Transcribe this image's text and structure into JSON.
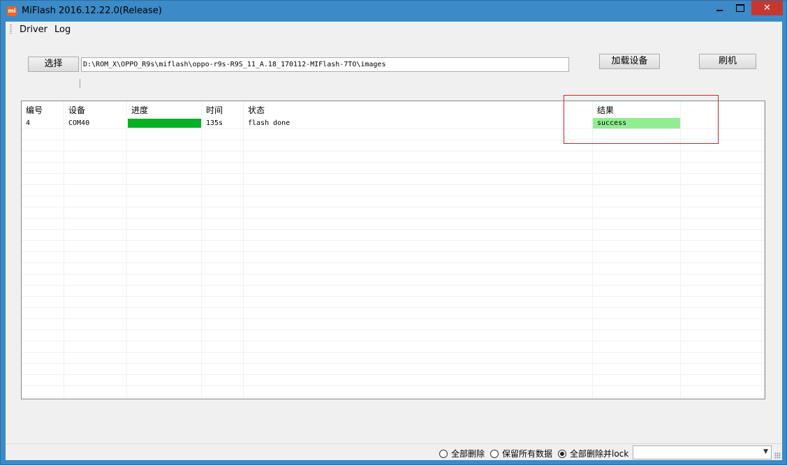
{
  "window": {
    "title": "MiFlash 2016.12.22.0(Release)",
    "app_icon_text": "mi",
    "close_glyph": "✕"
  },
  "menu": {
    "driver": "Driver",
    "log": "Log"
  },
  "toolbar": {
    "select_label": "选择",
    "path_value": "D:\\ROM_X\\OPPO_R9s\\miflash\\oppo-r9s-R9S_11_A.18_170112-MIFlash-7TO\\images",
    "load_device_label": "加载设备",
    "flash_label": "刷机"
  },
  "grid": {
    "columns": [
      "编号",
      "设备",
      "进度",
      "时间",
      "状态",
      "结果",
      ""
    ],
    "rows": [
      {
        "id": "4",
        "device": "COM40",
        "progress": 1.0,
        "time": "135s",
        "status": "flash done",
        "result": "success"
      }
    ]
  },
  "colors": {
    "progress_fill": "#06b025",
    "success_bg": "#90ee90",
    "highlight_border": "#e02020",
    "titlebar": "#3c8ac7",
    "close_button": "#c7372f"
  },
  "footer": {
    "options": [
      "全部删除",
      "保留所有数据",
      "全部删除并lock"
    ],
    "selected_option": "全部删除并lock",
    "combo_value": "",
    "combo_arrow": "▼"
  }
}
